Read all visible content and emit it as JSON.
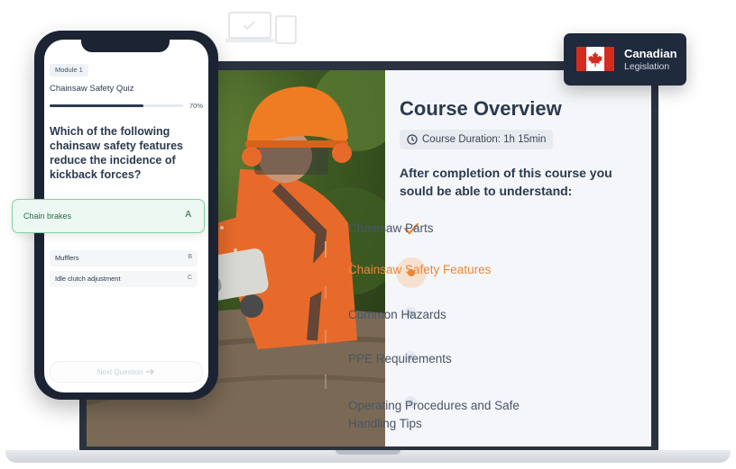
{
  "colors": {
    "laptop_frame": "#2b3240",
    "accent_orange": "#e8873a",
    "timeline_line": "#e2a062",
    "badge_bg": "#1f2a3c",
    "quiz_selected_border": "#7fd1a0",
    "text_dark": "#2b3a4e"
  },
  "course": {
    "title": "Course Overview",
    "duration": "Course Duration: 1h 15min",
    "subtitle": "After completion of this course you sould be able to understand:",
    "topics": [
      {
        "label": "Chainsaw Parts",
        "state": "completed",
        "icon": "check-icon"
      },
      {
        "label": "Chainsaw Safety Features",
        "state": "active",
        "icon": "active-dot-icon"
      },
      {
        "label": "Common Hazards",
        "state": "upcoming",
        "icon": "dot-icon"
      },
      {
        "label": "PPE Requirements",
        "state": "upcoming",
        "icon": "dot-icon"
      },
      {
        "label": "Operating Procedures and Safe Handling Tips",
        "state": "upcoming",
        "icon": "dot-icon"
      }
    ]
  },
  "badge": {
    "title": "Canadian",
    "subtitle": "Legislation",
    "icon": "canada-flag-icon"
  },
  "quiz": {
    "module": "Module 1",
    "title": "Chainsaw Safety Quiz",
    "progress": 0.7,
    "progress_label": "70%",
    "question": "Which of the following chainsaw safety features reduce the incidence of kickback forces?",
    "options": [
      {
        "label": "Chain brakes",
        "key": "A",
        "selected": true
      },
      {
        "label": "Mufflers",
        "key": "B",
        "selected": false
      },
      {
        "label": "Idle clutch adjustment",
        "key": "C",
        "selected": false
      }
    ],
    "next_label": "Next Question",
    "next_icon": "arrow-right-icon"
  }
}
